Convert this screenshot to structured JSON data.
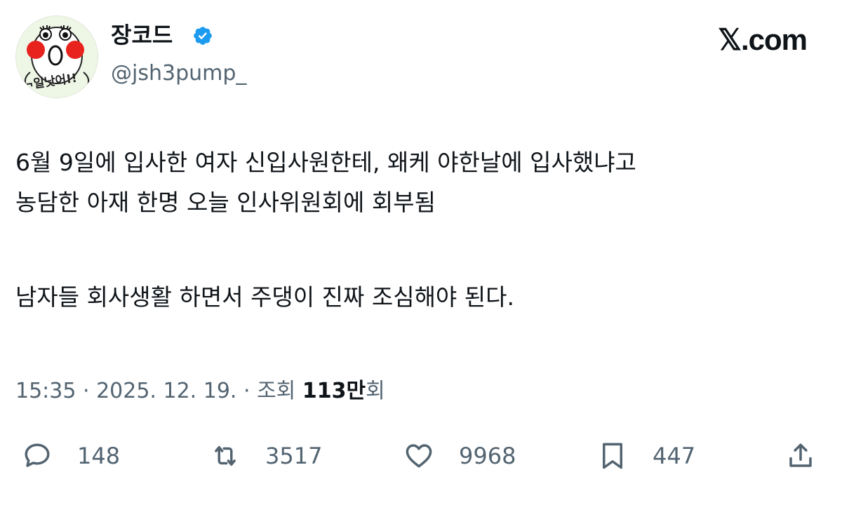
{
  "author": {
    "display_name": "장코드",
    "handle": "@jsh3pump_",
    "avatar_text": "¬일낫어!!"
  },
  "brand": "𝕏.com",
  "tweet": {
    "lines": [
      "6월 9일에 입사한 여자 신입사원한테, 왜케 야한날에 입사했냐고",
      "농담한 아재 한명 오늘 인사위원회에 회부됨",
      "남자들 회사생활 하면서 주댕이 진짜 조심해야 된다."
    ]
  },
  "meta": {
    "time": "15:35",
    "separator1": " · ",
    "date": "2025. 12. 19.",
    "separator2": " · ",
    "views_label": "조회 ",
    "views_number": "113",
    "views_unit": "만",
    "views_suffix": "회"
  },
  "actions": {
    "replies": "148",
    "retweets": "3517",
    "likes": "9968",
    "bookmarks": "447"
  },
  "colors": {
    "text": "#0f1419",
    "secondary": "#536471",
    "verified": "#1d9bf0"
  }
}
